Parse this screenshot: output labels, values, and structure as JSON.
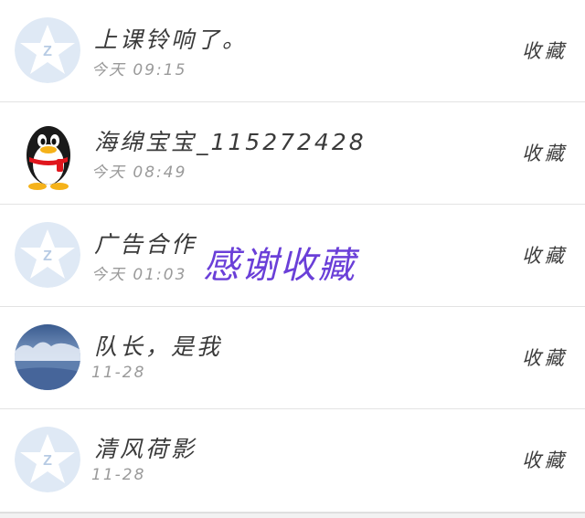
{
  "rows": [
    {
      "name": "上课铃响了。",
      "time": "今天 09:15",
      "action": "收藏",
      "avatar": "default-qzone-star-icon"
    },
    {
      "name": "海绵宝宝_115272428",
      "time": "今天 08:49",
      "action": "收藏",
      "avatar": "qq-penguin-icon"
    },
    {
      "name": "广告合作",
      "time": "今天 01:03",
      "action": "收藏",
      "avatar": "default-qzone-star-icon"
    },
    {
      "name": "队长，是我",
      "time": "11-28",
      "action": "收藏",
      "avatar": "snow-landscape-photo"
    },
    {
      "name": "清风荷影",
      "time": "11-28",
      "action": "收藏",
      "avatar": "default-qzone-star-icon"
    }
  ],
  "watermark": "感谢收藏",
  "colors": {
    "avatar_bg": "#dfe9f5",
    "avatar_star": "#ffffff",
    "watermark": "#6a3fd8",
    "divider": "#e3e3e3"
  }
}
